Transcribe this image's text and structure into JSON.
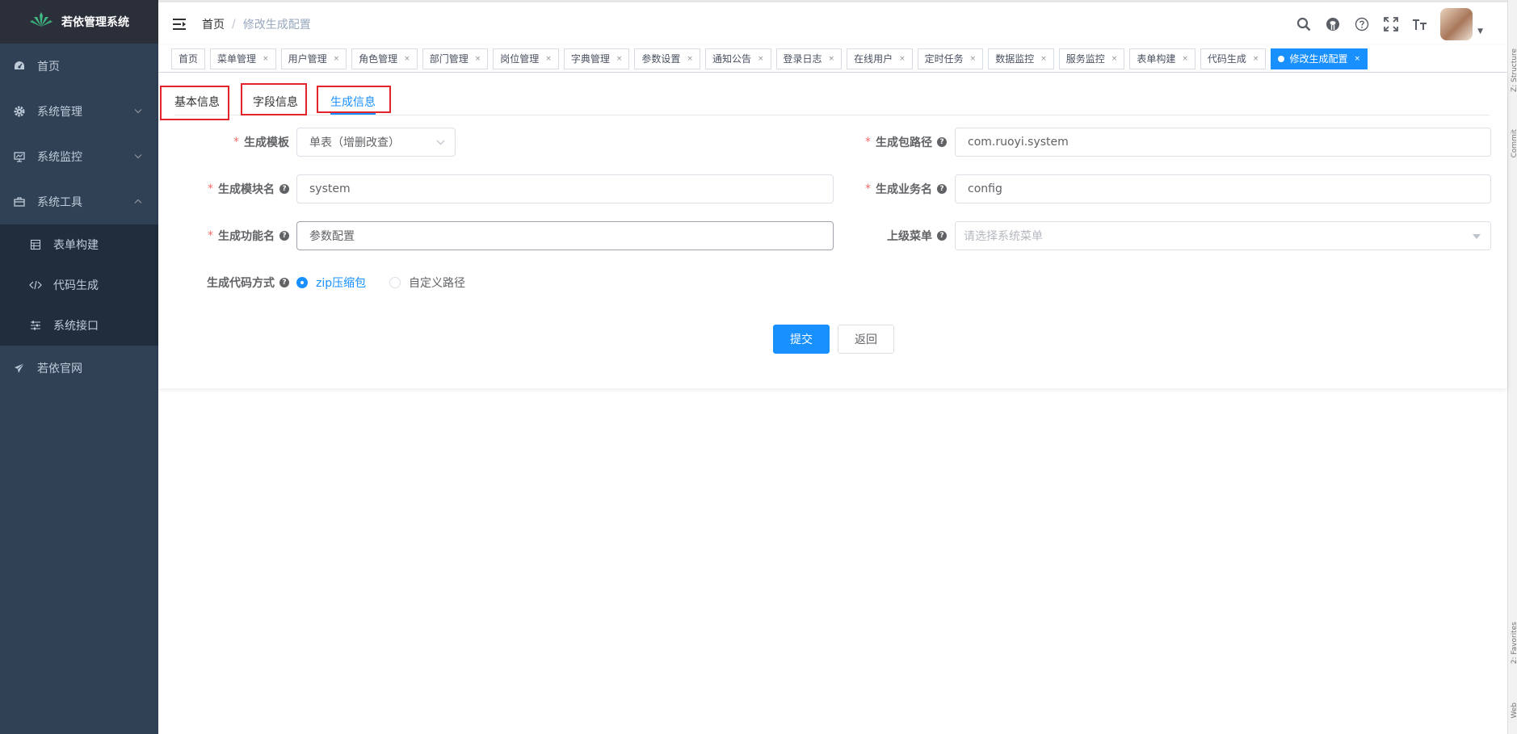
{
  "app": {
    "title": "若依管理系统"
  },
  "sidebar": {
    "items": [
      {
        "label": "首页",
        "icon": "dashboard-icon"
      },
      {
        "label": "系统管理",
        "icon": "gear-icon"
      },
      {
        "label": "系统监控",
        "icon": "monitor-icon"
      },
      {
        "label": "系统工具",
        "icon": "toolbox-icon"
      }
    ],
    "submenu": [
      {
        "label": "表单构建",
        "icon": "form-icon"
      },
      {
        "label": "代码生成",
        "icon": "code-icon"
      },
      {
        "label": "系统接口",
        "icon": "sliders-icon"
      }
    ],
    "external": {
      "label": "若依官网",
      "icon": "paper-plane-icon"
    }
  },
  "breadcrumb": {
    "home": "首页",
    "sep": "/",
    "current": "修改生成配置"
  },
  "tags": [
    {
      "label": "首页"
    },
    {
      "label": "菜单管理"
    },
    {
      "label": "用户管理"
    },
    {
      "label": "角色管理"
    },
    {
      "label": "部门管理"
    },
    {
      "label": "岗位管理"
    },
    {
      "label": "字典管理"
    },
    {
      "label": "参数设置"
    },
    {
      "label": "通知公告"
    },
    {
      "label": "登录日志"
    },
    {
      "label": "在线用户"
    },
    {
      "label": "定时任务"
    },
    {
      "label": "数据监控"
    },
    {
      "label": "服务监控"
    },
    {
      "label": "表单构建"
    },
    {
      "label": "代码生成"
    },
    {
      "label": "修改生成配置"
    }
  ],
  "tags_close": "×",
  "tabs": [
    {
      "label": "基本信息"
    },
    {
      "label": "字段信息"
    },
    {
      "label": "生成信息"
    }
  ],
  "form": {
    "template_label": "生成模板",
    "template_value": "单表（增删改查）",
    "package_label": "生成包路径",
    "package_value": "com.ruoyi.system",
    "module_label": "生成模块名",
    "module_value": "system",
    "business_label": "生成业务名",
    "business_value": "config",
    "function_label": "生成功能名",
    "function_value": "参数配置",
    "parent_menu_label": "上级菜单",
    "parent_menu_placeholder": "请选择系统菜单",
    "gen_type_label": "生成代码方式",
    "gen_type_zip": "zip压缩包",
    "gen_type_custom": "自定义路径",
    "required_mark": "*",
    "help_mark": "?"
  },
  "buttons": {
    "submit": "提交",
    "back": "返回"
  },
  "strip": {
    "structure": "Z: Structure",
    "commit": "Commit",
    "favorites": "2: Favorites",
    "web": "Web"
  },
  "colors": {
    "primary": "#1890ff",
    "sidebar": "#304156",
    "required": "#f56c6c",
    "highlight_box": "#e3242b"
  }
}
